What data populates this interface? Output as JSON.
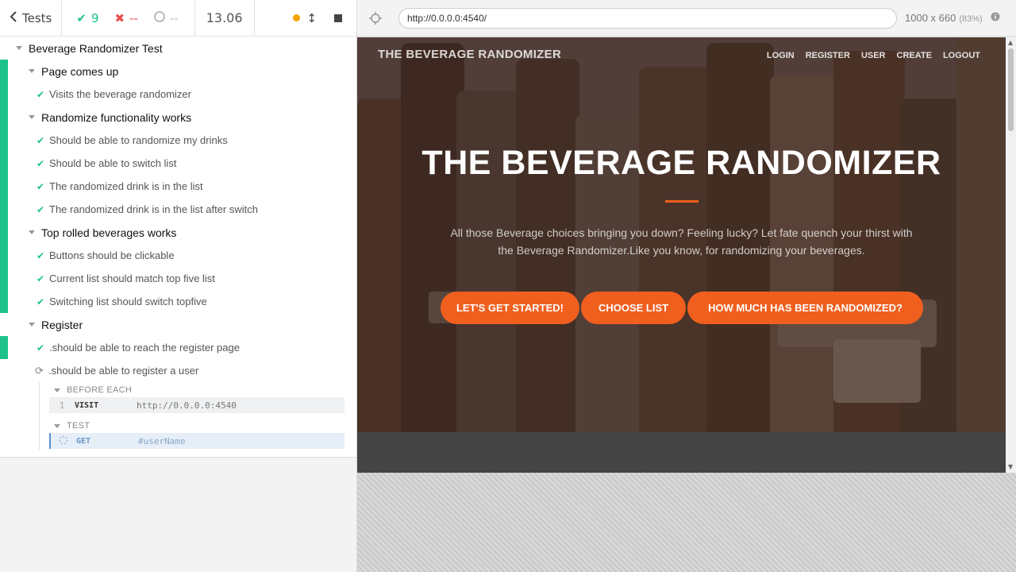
{
  "reporter": {
    "tests_label": "Tests",
    "passed": "9",
    "failed": "--",
    "pending": "--",
    "duration": "13.06",
    "suite": {
      "title": "Beverage Randomizer Test",
      "groups": [
        {
          "title": "Page comes up",
          "tests": [
            "Visits the beverage randomizer"
          ]
        },
        {
          "title": "Randomize functionality works",
          "tests": [
            "Should be able to randomize my drinks",
            "Should be able to switch list",
            "The randomized drink is in the list",
            "The randomized drink is in the list after switch"
          ]
        },
        {
          "title": "Top rolled beverages works",
          "tests": [
            "Buttons should be clickable",
            "Current list should match top five list",
            "Switching list should switch topfive"
          ]
        },
        {
          "title": "Register",
          "tests": [
            ".should be able to reach the register page",
            ".should be able to register a user"
          ]
        }
      ]
    },
    "commands": {
      "before_each_label": "BEFORE EACH",
      "test_label": "TEST",
      "visit": {
        "num": "1",
        "name": "VISIT",
        "message": "http://0.0.0.0:4540"
      },
      "get": {
        "name": "GET",
        "message": "#userName"
      }
    }
  },
  "aut": {
    "url": "http://0.0.0.0:4540/",
    "viewport": "1000 x 660",
    "scale": "(83%)",
    "brand": "THE BEVERAGE RANDOMIZER",
    "nav": [
      "LOGIN",
      "REGISTER",
      "USER",
      "CREATE",
      "LOGOUT"
    ],
    "headline": "THE BEVERAGE RANDOMIZER",
    "subtext": "All those Beverage choices bringing you down? Feeling lucky? Let fate quench your thirst with the Beverage Randomizer.Like you know, for randomizing your beverages.",
    "buttons": [
      "LET'S GET STARTED!",
      "CHOOSE LIST",
      "HOW MUCH HAS BEEN RANDOMIZED?"
    ],
    "accent_color": "#f05f1e"
  },
  "icons": {
    "back": "chevron-left-icon",
    "pass": "check-icon",
    "fail": "x-icon",
    "pending": "circle-icon",
    "running": "refresh-icon",
    "selector": "crosshair-icon"
  }
}
